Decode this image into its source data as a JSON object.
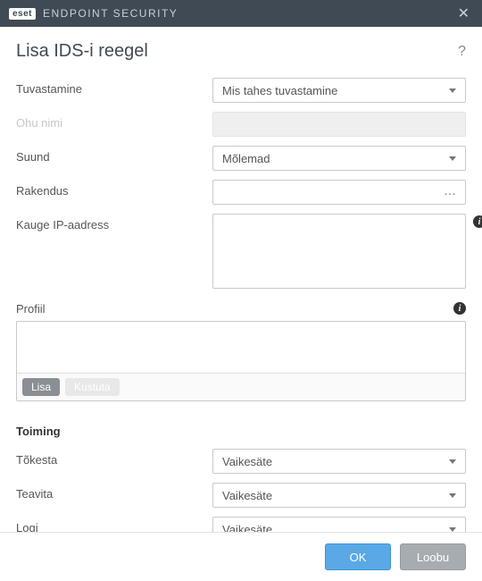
{
  "titlebar": {
    "brand_logo": "eset",
    "brand_text": "ENDPOINT SECURITY"
  },
  "dialog": {
    "title": "Lisa IDS-i reegel"
  },
  "fields": {
    "detection": {
      "label": "Tuvastamine",
      "value": "Mis tahes tuvastamine"
    },
    "threat_name": {
      "label": "Ohu nimi",
      "value": ""
    },
    "direction": {
      "label": "Suund",
      "value": "Mõlemad"
    },
    "application": {
      "label": "Rakendus",
      "value": ""
    },
    "remote_ip": {
      "label": "Kauge IP-aadress",
      "value": ""
    },
    "profile": {
      "label": "Profiil"
    }
  },
  "profile_buttons": {
    "add": "Lisa",
    "delete": "Kustuta"
  },
  "action_section": {
    "heading": "Toiming",
    "block": {
      "label": "Tõkesta",
      "value": "Vaikesäte"
    },
    "notify": {
      "label": "Teavita",
      "value": "Vaikesäte"
    },
    "log": {
      "label": "Logi",
      "value": "Vaikesäte"
    }
  },
  "footer": {
    "ok": "OK",
    "cancel": "Loobu"
  }
}
